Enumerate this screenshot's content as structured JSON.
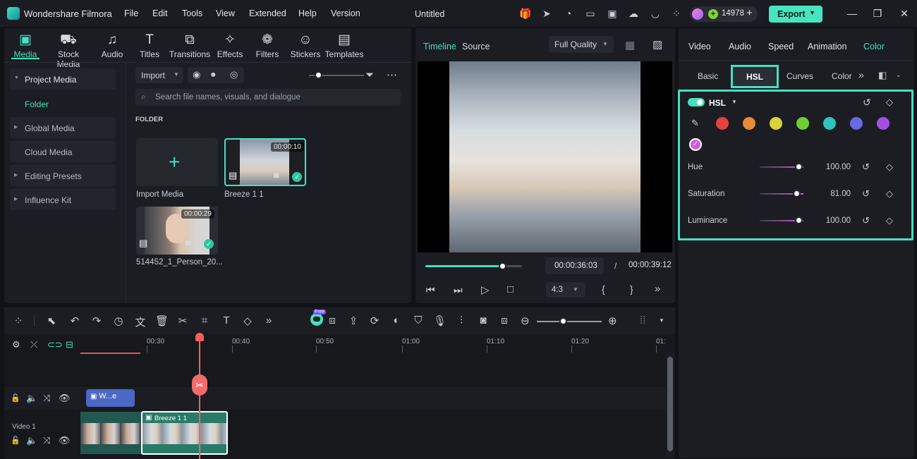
{
  "app": {
    "name": "Wondershare Filmora",
    "doc_title": "Untitled",
    "credits": "14978",
    "export_label": "Export"
  },
  "menu": [
    "File",
    "Edit",
    "Tools",
    "View",
    "Extended",
    "Help",
    "Version"
  ],
  "toolbar": [
    {
      "label": "Media",
      "icon": "media-icon",
      "glyph": "▣"
    },
    {
      "label": "Stock Media",
      "icon": "stock-media-icon",
      "glyph": "⛟"
    },
    {
      "label": "Audio",
      "icon": "audio-icon",
      "glyph": "♫"
    },
    {
      "label": "Titles",
      "icon": "titles-icon",
      "glyph": "T"
    },
    {
      "label": "Transitions",
      "icon": "transitions-icon",
      "glyph": "⧉"
    },
    {
      "label": "Effects",
      "icon": "effects-icon",
      "glyph": "✧"
    },
    {
      "label": "Filters",
      "icon": "filters-icon",
      "glyph": "❁"
    },
    {
      "label": "Stickers",
      "icon": "stickers-icon",
      "glyph": "☺"
    },
    {
      "label": "Templates",
      "icon": "templates-icon",
      "glyph": "▤"
    }
  ],
  "sidebar": {
    "items": [
      "Project Media",
      "Folder",
      "Global Media",
      "Cloud Media",
      "Editing Presets",
      "Influence Kit"
    ]
  },
  "media": {
    "import_label": "Import",
    "search_placeholder": "Search file names, visuals, and dialogue",
    "folder_heading": "FOLDER",
    "import_media_label": "Import Media",
    "clips": [
      {
        "name": "Breeze 1 1",
        "duration": "00:00:10"
      },
      {
        "name": "514452_1_Person_20...",
        "duration": "00:00:29"
      }
    ]
  },
  "preview": {
    "tabs": [
      "Timeline",
      "Source"
    ],
    "quality": "Full Quality",
    "current_time": "00:00:36:03",
    "separator": "/",
    "total_time": "00:00:39:12",
    "aspect": "4:3",
    "progress": 0.8
  },
  "right": {
    "tabs": [
      "Video",
      "Audio",
      "Speed",
      "Animation",
      "Color"
    ],
    "subtabs": [
      "Basic",
      "HSL",
      "Curves",
      "Color"
    ],
    "hsl_label": "HSL",
    "sliders": [
      {
        "label": "Hue",
        "value": "100.00",
        "level": 0.9
      },
      {
        "label": "Saturation",
        "value": "81.00",
        "level": 0.85
      },
      {
        "label": "Luminance",
        "value": "100.00",
        "level": 0.9
      }
    ],
    "colors": [
      "#e5423e",
      "#e88a38",
      "#d8d33a",
      "#6ccf33",
      "#2fc3bf",
      "#6a68e4",
      "#a350e2",
      "#d35ad6"
    ]
  },
  "timeline": {
    "ruler": [
      "00:30",
      "00:40",
      "00:50",
      "01:00",
      "01:10",
      "01:20",
      "01:"
    ],
    "title_clip": "W...e",
    "video_clip": "Breeze 1 1",
    "track_label": "Video 1",
    "free_badge": "Free"
  }
}
